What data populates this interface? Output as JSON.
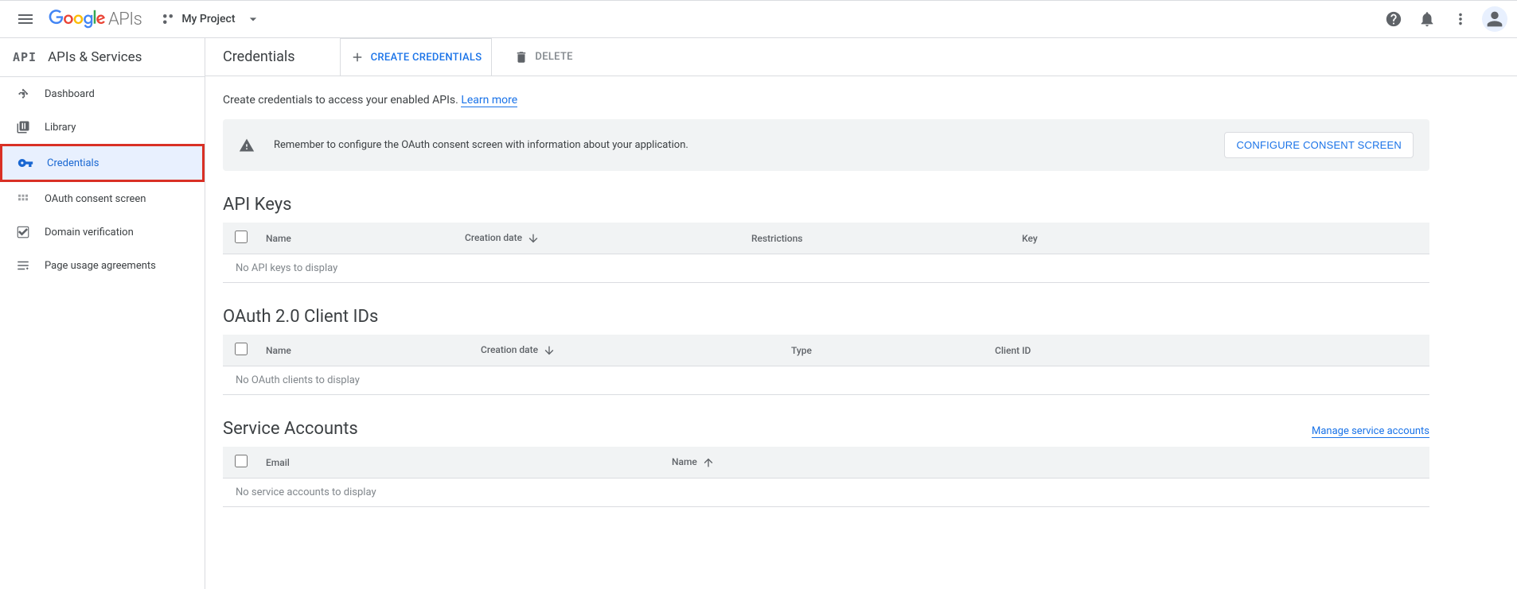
{
  "top": {
    "logo_suffix": "APIs",
    "project_name": "My Project"
  },
  "sidebar": {
    "badge": "API",
    "title": "APIs & Services",
    "items": [
      {
        "label": "Dashboard"
      },
      {
        "label": "Library"
      },
      {
        "label": "Credentials"
      },
      {
        "label": "OAuth consent screen"
      },
      {
        "label": "Domain verification"
      },
      {
        "label": "Page usage agreements"
      }
    ]
  },
  "page": {
    "title": "Credentials",
    "create_btn": "CREATE CREDENTIALS",
    "delete_btn": "DELETE",
    "intro_text": "Create credentials to access your enabled APIs. ",
    "learn_more": "Learn more"
  },
  "alert": {
    "text": "Remember to configure the OAuth consent screen with information about your application.",
    "button": "CONFIGURE CONSENT SCREEN"
  },
  "sections": {
    "api_keys": {
      "title": "API Keys",
      "headers": {
        "name": "Name",
        "creation": "Creation date",
        "restrictions": "Restrictions",
        "key": "Key"
      },
      "empty": "No API keys to display"
    },
    "oauth": {
      "title": "OAuth 2.0 Client IDs",
      "headers": {
        "name": "Name",
        "creation": "Creation date",
        "type": "Type",
        "client_id": "Client ID"
      },
      "empty": "No OAuth clients to display"
    },
    "service": {
      "title": "Service Accounts",
      "manage": "Manage service accounts",
      "headers": {
        "email": "Email",
        "name": "Name"
      },
      "empty": "No service accounts to display"
    }
  }
}
